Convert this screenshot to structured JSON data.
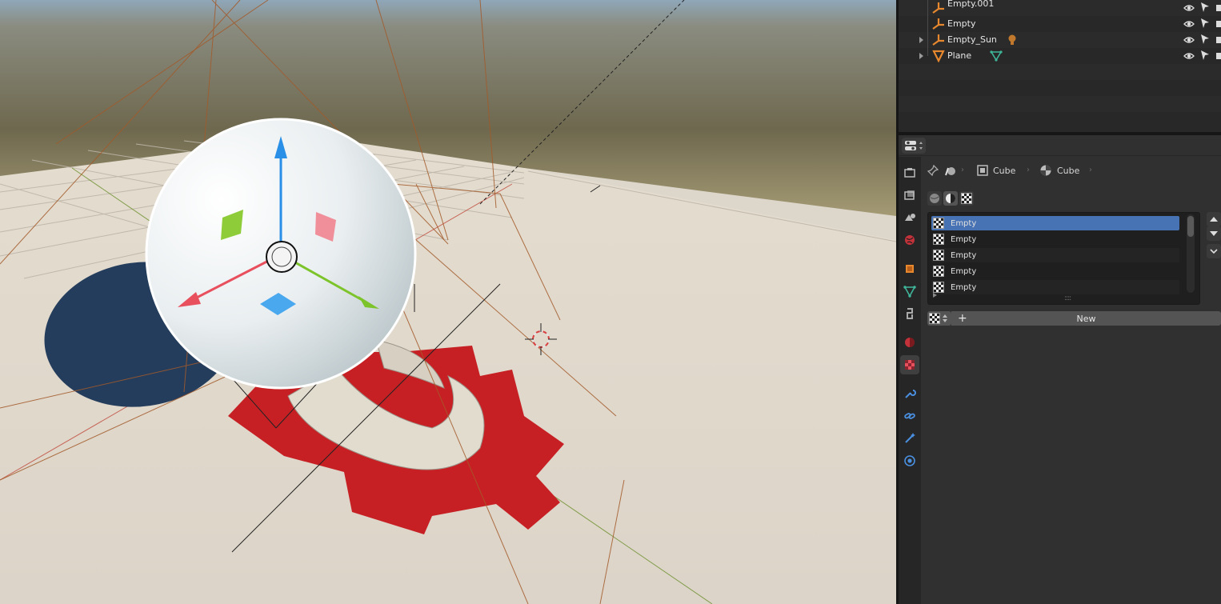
{
  "outliner": {
    "rows": [
      {
        "label": "Empty.001",
        "icon": "empty-icon",
        "color": "#e8882e"
      },
      {
        "label": "Empty",
        "icon": "empty-icon",
        "color": "#e8882e"
      },
      {
        "label": "Empty_Sun",
        "icon": "empty-icon",
        "color": "#e8882e",
        "extra": "light-icon"
      },
      {
        "label": "Plane",
        "icon": "mesh-object-icon",
        "color": "#e8882e",
        "extra": "mesh-data-icon"
      }
    ]
  },
  "properties": {
    "breadcrumb": {
      "object": "Cube",
      "material": "Cube"
    },
    "material_slots": [
      "Empty",
      "Empty",
      "Empty",
      "Empty",
      "Empty"
    ],
    "active_slot_index": 0,
    "new_button": "New",
    "new_plus": "+",
    "tabs": [
      "tool-icon",
      "render-icon",
      "output-icon",
      "view-layer-icon",
      "scene-icon",
      "world-icon",
      "object-icon",
      "modifiers-icon",
      "particles-icon",
      "physics-icon",
      "constraints-icon",
      "data-icon",
      "material-icon"
    ]
  },
  "colors": {
    "accent": "#4772b3",
    "object_orange": "#e8882e",
    "mesh_green": "#3fb59a",
    "gear_red": "#c72024"
  }
}
